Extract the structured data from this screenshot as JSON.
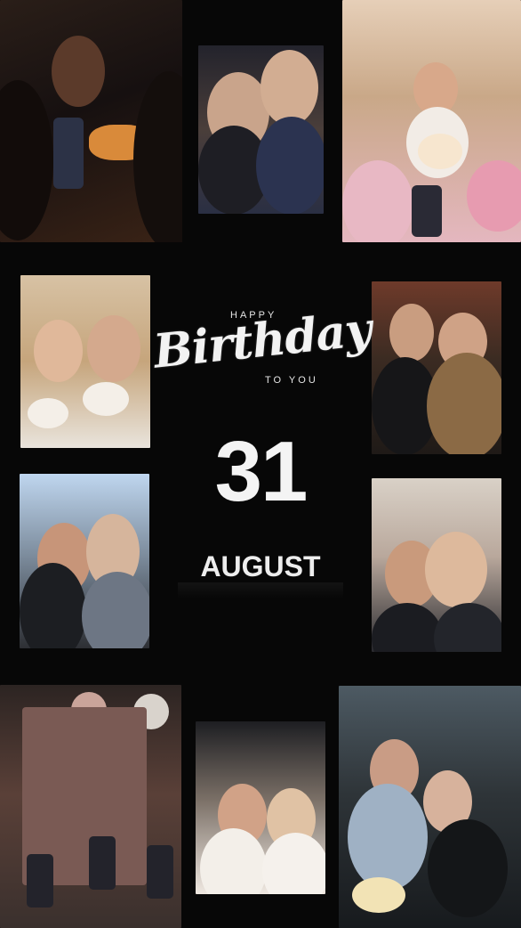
{
  "greeting": {
    "happy": "HAPPY",
    "birthday": "Birthday",
    "to_you": "TO YOU"
  },
  "date": {
    "day": "31",
    "month": "AUGUST"
  },
  "colors": {
    "background": "#070707",
    "text": "#f2f2f2"
  }
}
